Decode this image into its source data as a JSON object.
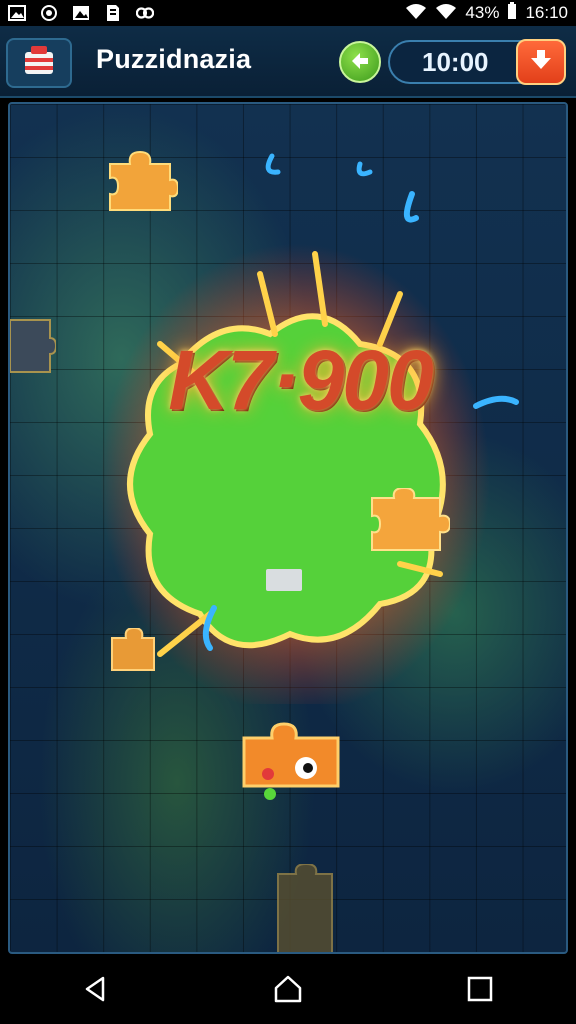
{
  "status": {
    "battery": "43%",
    "time": "16:10",
    "icons": [
      "image-icon",
      "circle-icon",
      "picture-icon",
      "file-icon",
      "link-icon"
    ]
  },
  "header": {
    "title": "Puzzidnazia",
    "timer": "10:00"
  },
  "board": {
    "score": "K7·900"
  },
  "colors": {
    "accent_orange": "#e2401a",
    "accent_green": "#3c9a1c",
    "board_bg": "#0d2540",
    "glow_green": "#58d63a"
  },
  "nav": {
    "icons": [
      "back-icon",
      "home-icon",
      "recents-icon"
    ]
  }
}
